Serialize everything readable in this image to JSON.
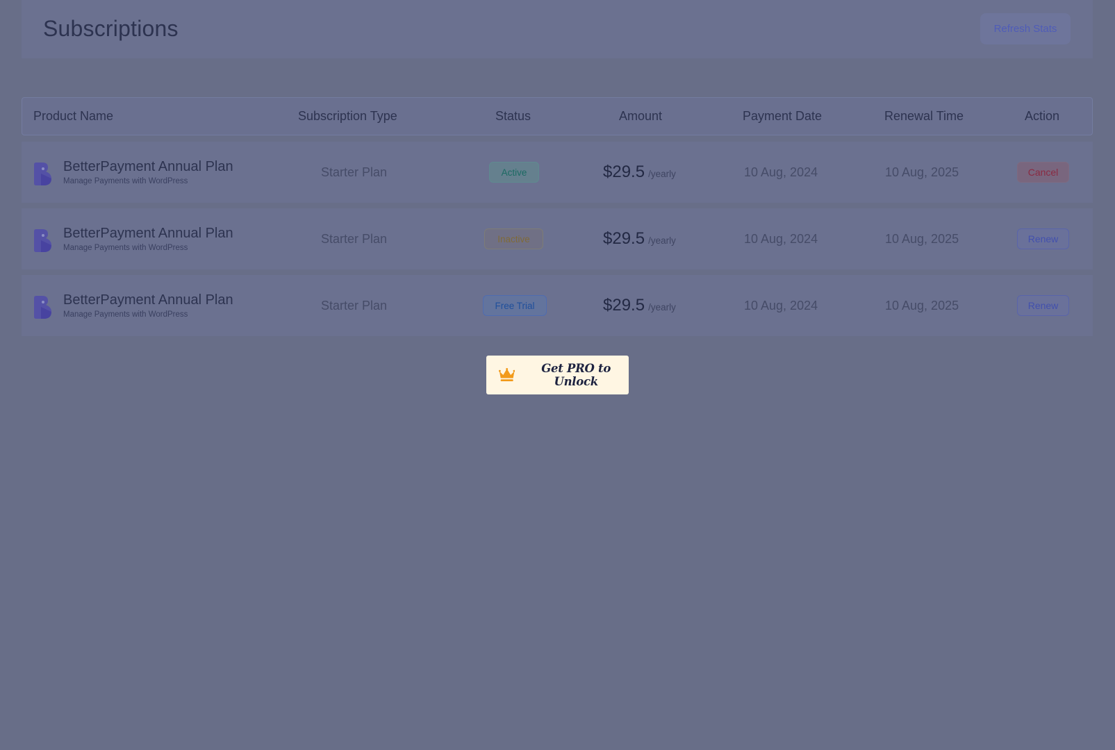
{
  "header": {
    "title": "Subscriptions",
    "refresh_label": "Refresh Stats"
  },
  "table": {
    "columns": [
      "Product Name",
      "Subscription Type",
      "Status",
      "Amount",
      "Payment Date",
      "Renewal Time",
      "Action"
    ],
    "rows": [
      {
        "product_name": "BetterPayment Annual Plan",
        "product_subtitle": "Manage Payments with WordPress",
        "subscription_type": "Starter Plan",
        "status": "Active",
        "amount": "$29.5",
        "period": "/yearly",
        "payment_date": "10 Aug, 2024",
        "renewal_time": "10 Aug, 2025",
        "action": "Cancel"
      },
      {
        "product_name": "BetterPayment Annual Plan",
        "product_subtitle": "Manage Payments with WordPress",
        "subscription_type": "Starter Plan",
        "status": "Inactive",
        "amount": "$29.5",
        "period": "/yearly",
        "payment_date": "10 Aug, 2024",
        "renewal_time": "10 Aug, 2025",
        "action": "Renew"
      },
      {
        "product_name": "BetterPayment Annual Plan",
        "product_subtitle": "Manage Payments with WordPress",
        "subscription_type": "Starter Plan",
        "status": "Free Trial",
        "amount": "$29.5",
        "period": "/yearly",
        "payment_date": "10 Aug, 2024",
        "renewal_time": "10 Aug, 2025",
        "action": "Renew"
      }
    ]
  },
  "pro": {
    "label": "Get PRO to Unlock",
    "icon": "crown-icon"
  },
  "colors": {
    "overlay": "#686e88",
    "active": "#1c6a63",
    "inactive": "#7f6a38",
    "trial": "#1f4f9c",
    "cancel": "#8a2a42",
    "renew": "#4250ad",
    "pro_bg": "#fff6e3",
    "crown": "#f29a1a"
  }
}
